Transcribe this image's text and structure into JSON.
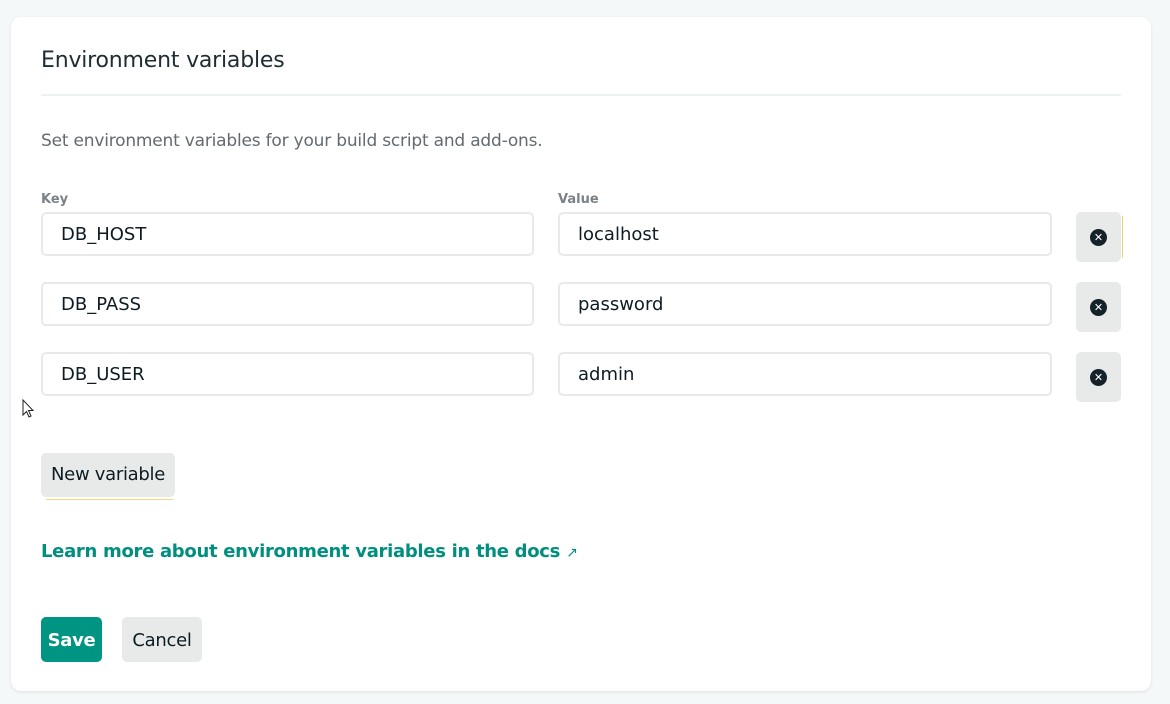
{
  "section": {
    "title": "Environment variables",
    "description": "Set environment variables for your build script and add-ons."
  },
  "columns": {
    "key_label": "Key",
    "value_label": "Value"
  },
  "variables": [
    {
      "key": "DB_HOST",
      "value": "localhost",
      "delete_icon": "close-circle-icon"
    },
    {
      "key": "DB_PASS",
      "value": "password",
      "delete_icon": "close-circle-icon"
    },
    {
      "key": "DB_USER",
      "value": "admin",
      "delete_icon": "close-circle-icon"
    }
  ],
  "actions": {
    "new_variable_label": "New variable",
    "docs_link_label": "Learn more about environment variables in the docs",
    "docs_link_icon": "↗",
    "save_label": "Save",
    "cancel_label": "Cancel"
  },
  "colors": {
    "accent": "#009482",
    "link": "#008f7f",
    "button_gray": "#e8eaea"
  }
}
